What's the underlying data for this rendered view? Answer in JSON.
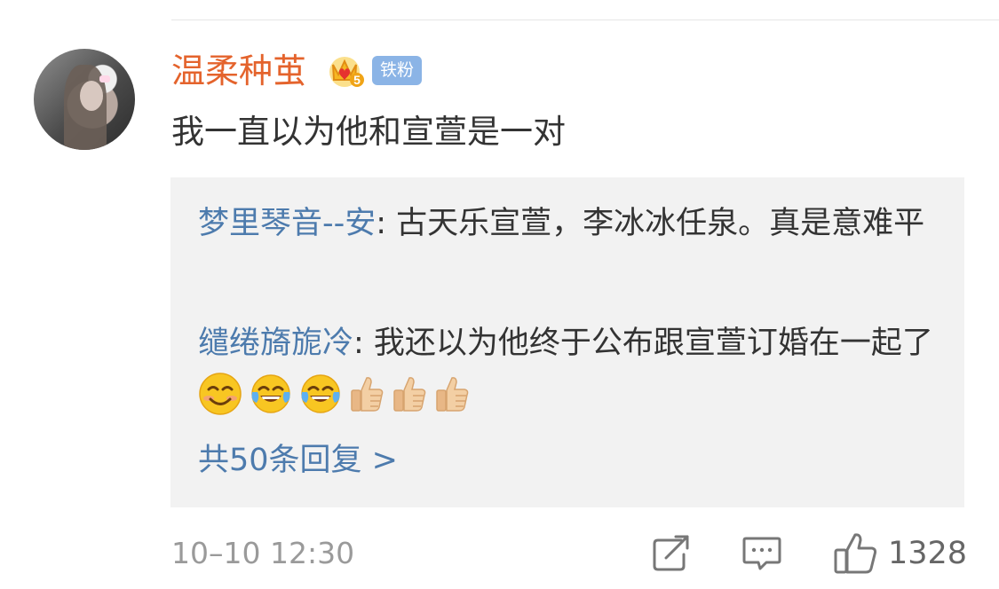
{
  "comment": {
    "username": "温柔种茧",
    "fan_badge": "铁粉",
    "text": "我一直以为他和宣萱是一对"
  },
  "replies": [
    {
      "author": "梦里琴音--安",
      "text": ": 古天乐宣萱，李冰冰任泉。真是意难平"
    },
    {
      "author": "缱绻旖旎冷",
      "text": ": 我还以为他终于公布跟宣萱订婚在一起了"
    }
  ],
  "more_replies": "共50条回复 >",
  "footer": {
    "timestamp": "10–10 12:30",
    "like_count": "1328"
  },
  "icons": {
    "crown_badge": "crown-level-5-icon",
    "reply_2_emojis": [
      "smiling-face-icon",
      "joy-face-icon",
      "joy-face-icon",
      "thumbs-up-icon",
      "thumbs-up-icon",
      "thumbs-up-icon"
    ],
    "share": "share-icon",
    "comment": "comment-icon",
    "like": "thumbs-up-outline-icon"
  },
  "colors": {
    "username": "#e4632c",
    "link": "#4d7bad",
    "fan_badge_bg": "#8bb4e6",
    "reply_box_bg": "#f2f2f2",
    "meta_text": "#9a9a9a"
  }
}
